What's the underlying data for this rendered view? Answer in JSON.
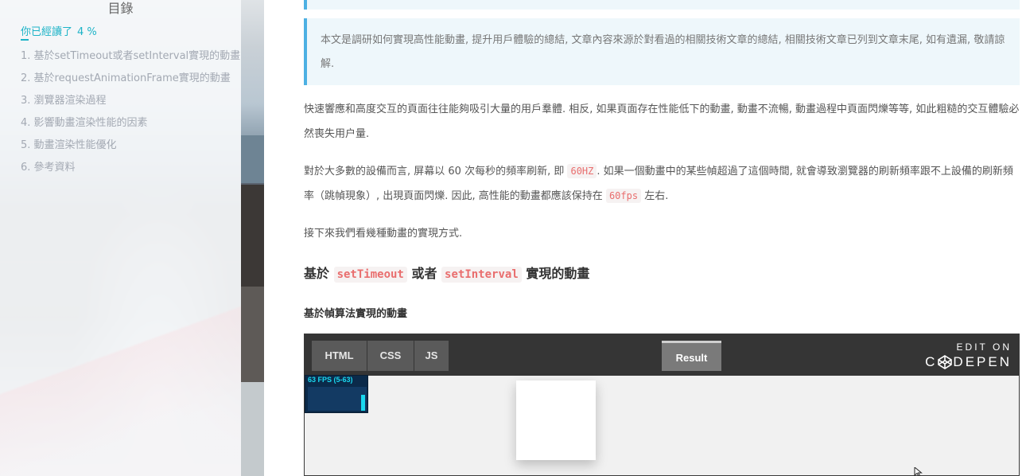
{
  "sidebar": {
    "title": "目錄",
    "progress_label": "你已經讀了",
    "progress_value": "4 %",
    "items": [
      {
        "label": "1. 基於setTimeout或者setInterval實現的動畫"
      },
      {
        "label": "2. 基於requestAnimationFrame實現的動畫"
      },
      {
        "label": "3. 瀏覽器渲染過程"
      },
      {
        "label": "4. 影響動畫渲染性能的因素"
      },
      {
        "label": "5. 動畫渲染性能優化"
      },
      {
        "label": "6. 參考資料"
      }
    ]
  },
  "article": {
    "intro_quote": "本文是調研如何實現高性能動畫, 提升用戶體驗的總結, 文章內容來源於對看過的相關技術文章的總結, 相關技術文章已列到文章末尾, 如有遺漏, 敬請諒解.",
    "p1": "快速響應和高度交互的頁面往往能夠吸引大量的用戶羣體. 相反, 如果頁面存在性能低下的動畫, 動畫不流暢, 動畫過程中頁面閃爍等等, 如此粗糙的交互體驗必然喪失用户量.",
    "p2_a": "對於大多數的設備而言, 屏幕以 60 次每秒的頻率刷新, 即 ",
    "p2_code1": "60HZ",
    "p2_b": ". 如果一個動畫中的某些幀超過了這個時間, 就會導致瀏覽器的刷新頻率跟不上設備的刷新頻率（跳幀現象）, 出現頁面閃爍. 因此, 高性能的動畫都應該保持在 ",
    "p2_code2": "60fps",
    "p2_c": " 左右.",
    "p3": "接下來我們看幾種動畫的實現方式.",
    "h2_a": "基於 ",
    "h2_code1": "setTimeout",
    "h2_b": " 或者 ",
    "h2_code2": "setInterval",
    "h2_c": " 實現的動畫",
    "h3": "基於幀算法實現的動畫"
  },
  "codepen": {
    "tabs": {
      "html": "HTML",
      "css": "CSS",
      "js": "JS"
    },
    "result_label": "Result",
    "edit_on": "EDIT ON",
    "brand_c": "C",
    "brand_rest": "DEPEN",
    "fps_text": "63 FPS (5-63)"
  },
  "colors": {
    "accent": "#1bb3c7",
    "quote_border": "#4db0e3",
    "code_text": "#e96e6e",
    "codepen_header": "#353535",
    "fps_bg": "#0b2a4a",
    "fps_fg": "#19d8ef"
  }
}
